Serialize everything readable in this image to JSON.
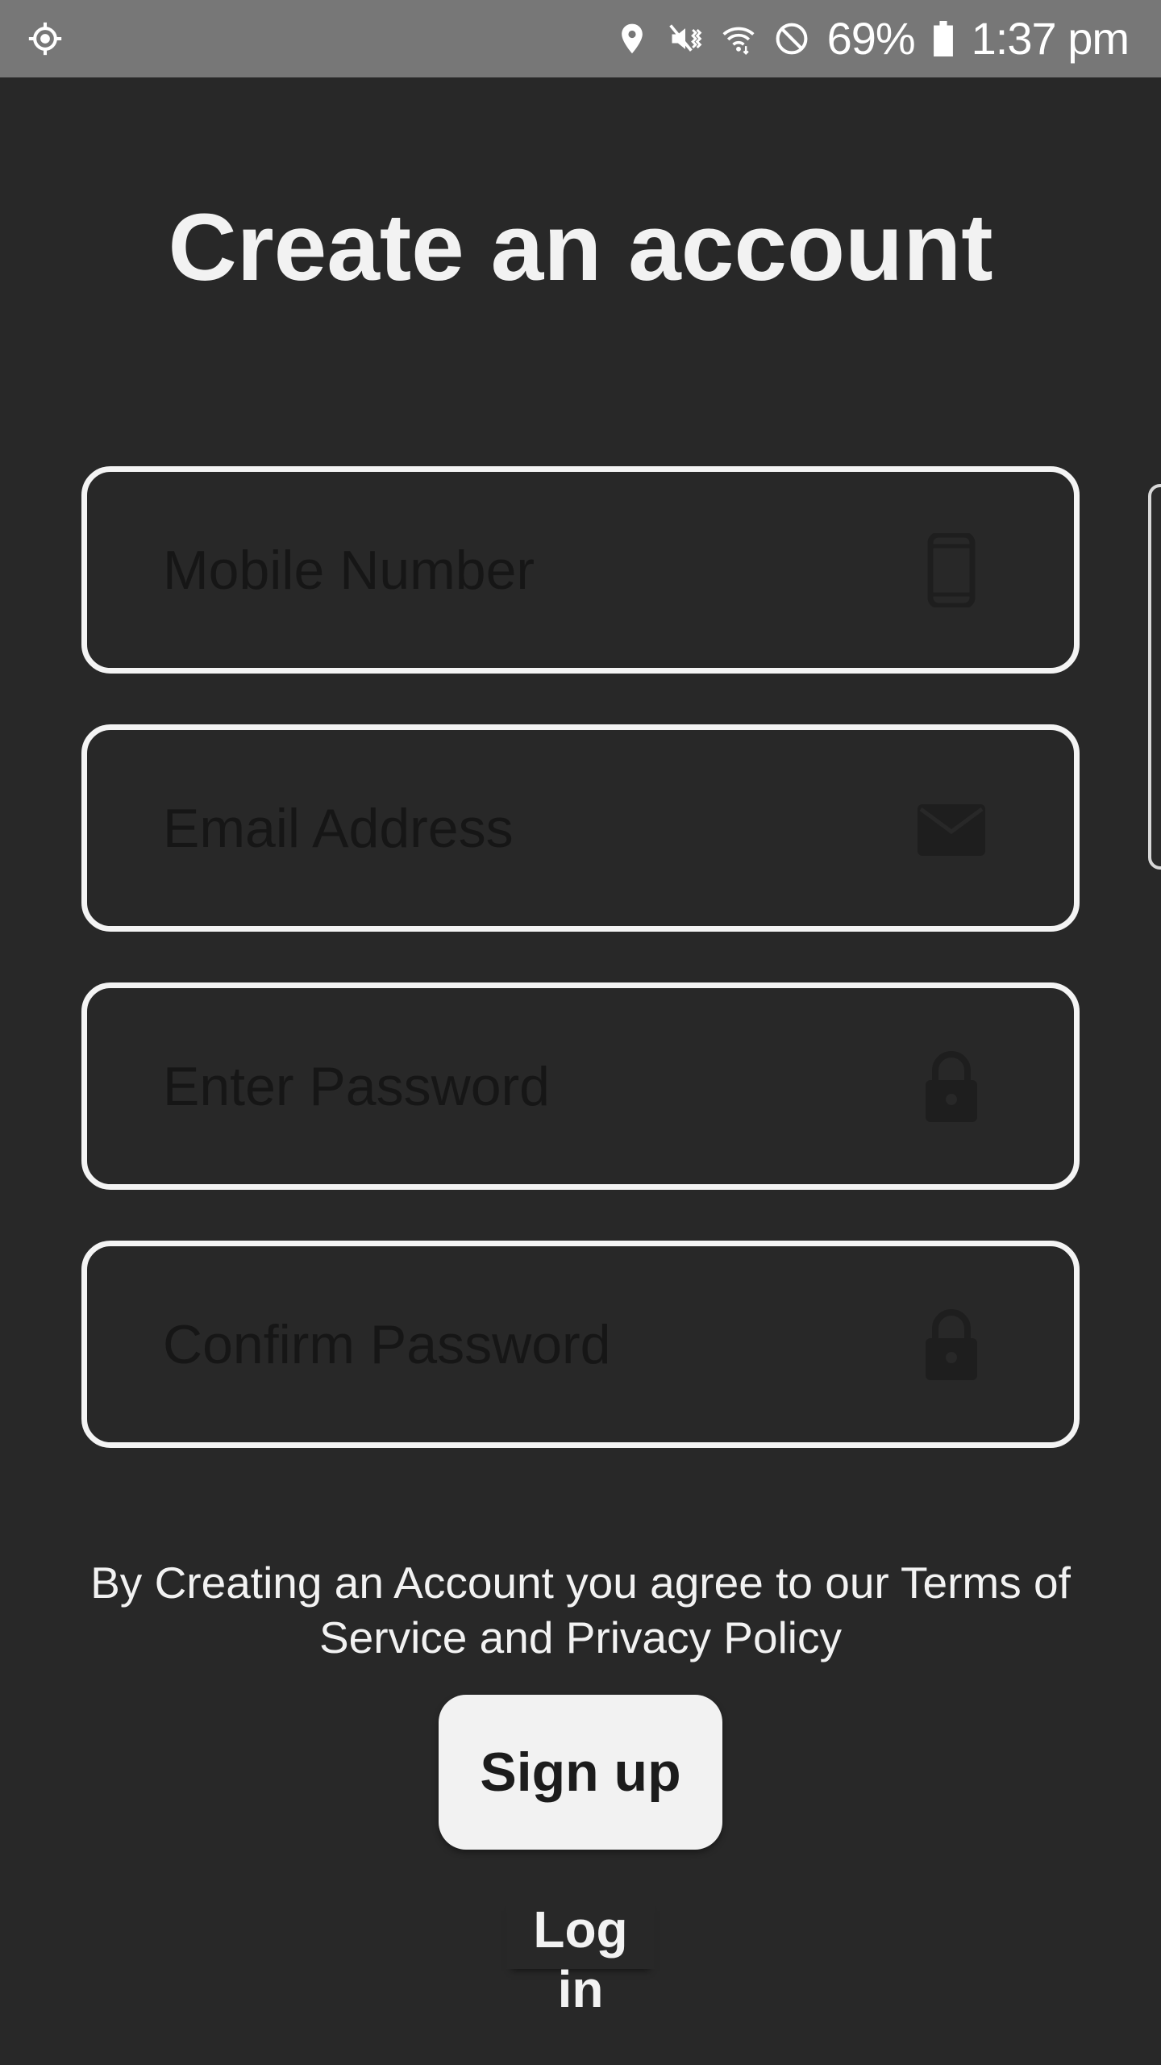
{
  "status_bar": {
    "icons": [
      "gps-locate-icon",
      "location-pin-icon",
      "vibrate-mute-icon",
      "wifi-icon",
      "do-not-disturb-icon",
      "battery-icon"
    ],
    "battery_percent": "69%",
    "time": "1:37 pm"
  },
  "page": {
    "title": "Create an account"
  },
  "form": {
    "mobile": {
      "placeholder": "Mobile Number",
      "value": "",
      "icon": "phone-icon"
    },
    "email": {
      "placeholder": "Email Address",
      "value": "",
      "icon": "mail-icon"
    },
    "password": {
      "placeholder": "Enter Password",
      "value": "",
      "icon": "lock-icon"
    },
    "confirm_password": {
      "placeholder": "Confirm Password",
      "value": "",
      "icon": "lock-icon"
    }
  },
  "terms_text": "By Creating an Account you agree to our Terms of Service and Privacy Policy",
  "actions": {
    "signup_label": "Sign up",
    "login_label": "Log in"
  },
  "colors": {
    "background": "#282828",
    "status_bar": "#777777",
    "field_border": "#f4f4f4",
    "button_bg": "#f2f2f2",
    "text": "#f2f2f2"
  }
}
